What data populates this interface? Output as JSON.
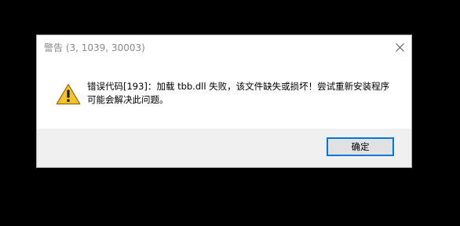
{
  "dialog": {
    "title": "警告 (3, 1039, 30003)",
    "message": "错误代码[193]：加载 tbb.dll 失败，该文件缺失或损坏！尝试重新安装程序可能会解决此问题。",
    "ok_label": "确定",
    "icons": {
      "warning": "warning-triangle-icon",
      "close": "close-icon"
    }
  },
  "colors": {
    "background": "#000000",
    "dialog_body": "#ffffff",
    "footer": "#f0f0f0",
    "title_text": "#8a8a8a",
    "button_border": "#0078d7",
    "button_fill": "#e1e1e1",
    "warning_fill": "#f6c42a"
  }
}
